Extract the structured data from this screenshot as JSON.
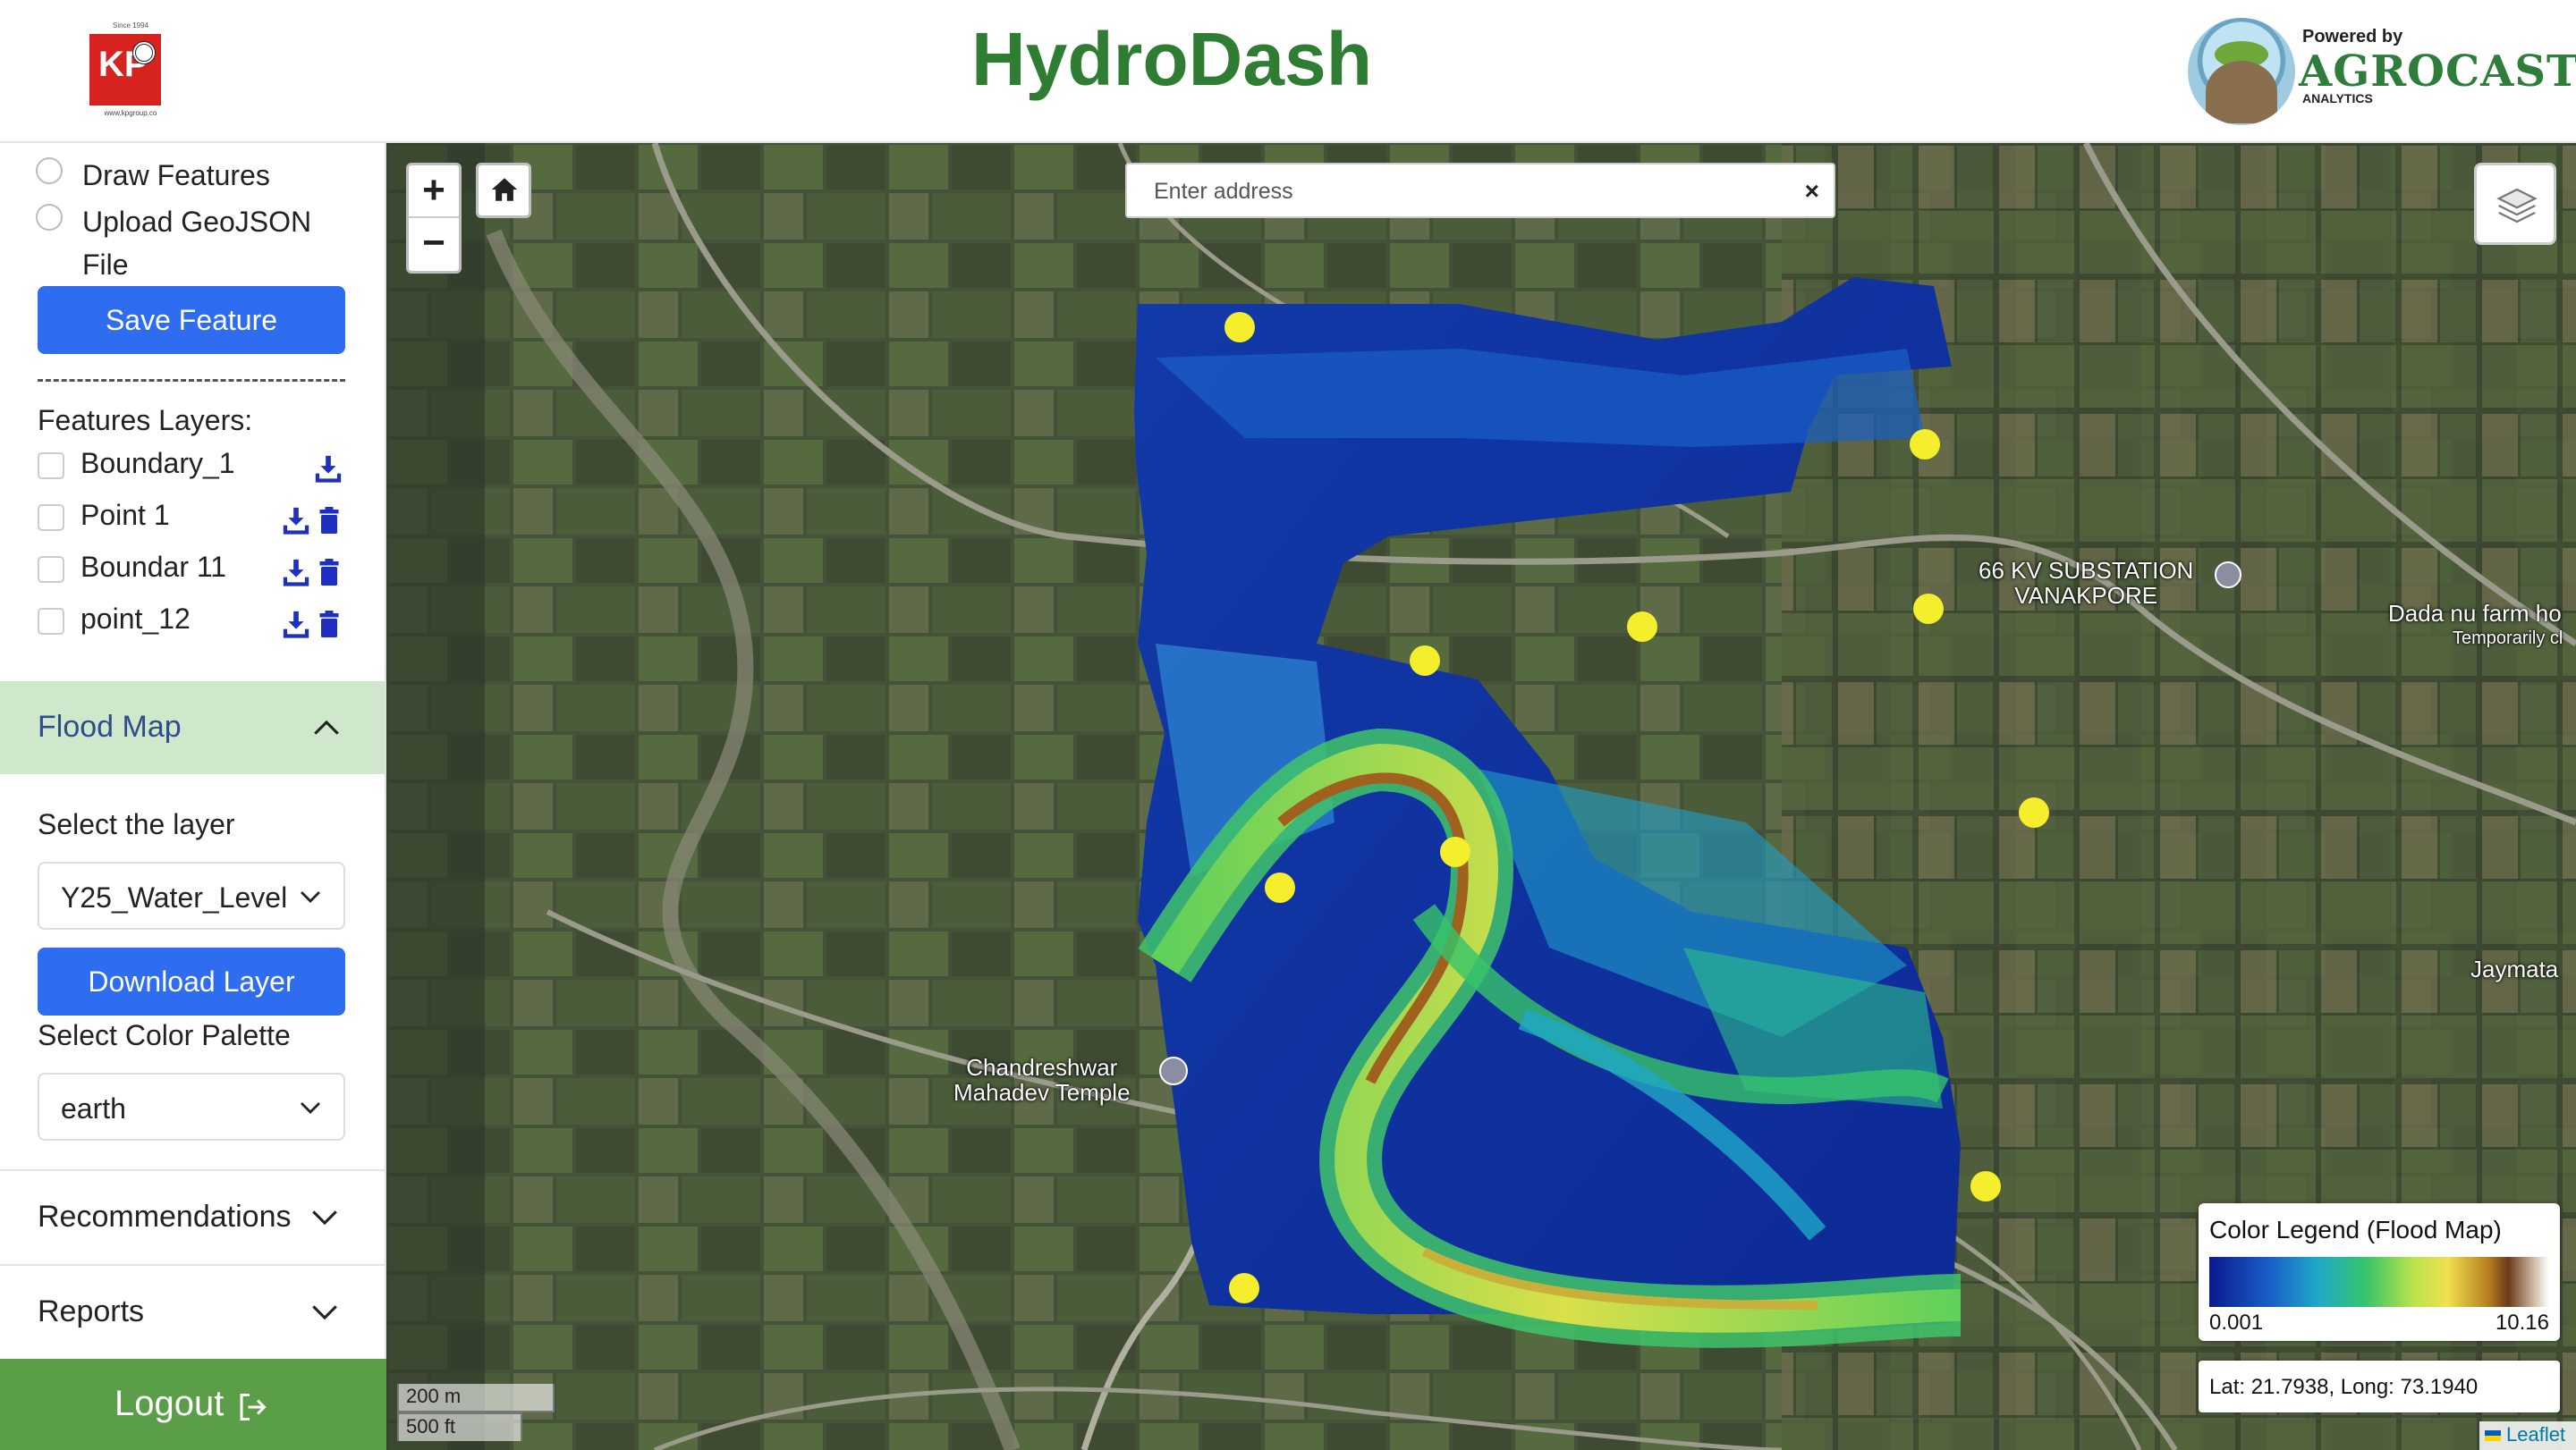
{
  "header": {
    "title": "HydroDash",
    "left_logo": {
      "since": "Since 1994",
      "url": "www.kpgroup.co",
      "letters": "KP"
    },
    "right_logo": {
      "powered_by": "Powered by",
      "name": "AGROCAST",
      "sub": "ANALYTICS"
    }
  },
  "sidebar": {
    "radios": [
      {
        "label": "Draw Features"
      },
      {
        "label": "Upload GeoJSON File"
      }
    ],
    "save_label": "Save Feature",
    "features_title": "Features Layers:",
    "features": [
      {
        "label": "Boundary_1",
        "deletable": false
      },
      {
        "label": "Point 1",
        "deletable": true
      },
      {
        "label": "Boundar 11",
        "deletable": true
      },
      {
        "label": "point_12",
        "deletable": true
      }
    ],
    "flood": {
      "title": "Flood Map",
      "select_layer_label": "Select the layer",
      "layer_value": "Y25_Water_Level",
      "download_label": "Download Layer",
      "palette_label": "Select Color Palette",
      "palette_value": "earth"
    },
    "recommendations": "Recommendations",
    "reports": "Reports",
    "logout": "Logout"
  },
  "map": {
    "search_placeholder": "Enter address",
    "search_clear": "×",
    "zoom_in": "+",
    "zoom_out": "−",
    "labels": {
      "substation": "66 KV SUBSTATION\nVANAKPORE",
      "temple": "Chandreshwar\nMahadev Temple",
      "farm": "Dada nu farm ho",
      "farm_sub": "Temporarily cl",
      "village": "Jaymata"
    },
    "legend": {
      "title": "Color Legend (Flood Map)",
      "min": "0.001",
      "max": "10.16"
    },
    "coords": "Lat: 21.7938, Long: 73.1940",
    "scale_m": "200 m",
    "scale_ft": "500 ft",
    "attribution": "Leaflet",
    "pin_color": "#f5ee2c"
  },
  "colors": {
    "accent_blue": "#2f6df0",
    "title_green": "#2e7d32",
    "logout_green": "#5a9e47",
    "accordion_bg": "#cfe8cc"
  }
}
